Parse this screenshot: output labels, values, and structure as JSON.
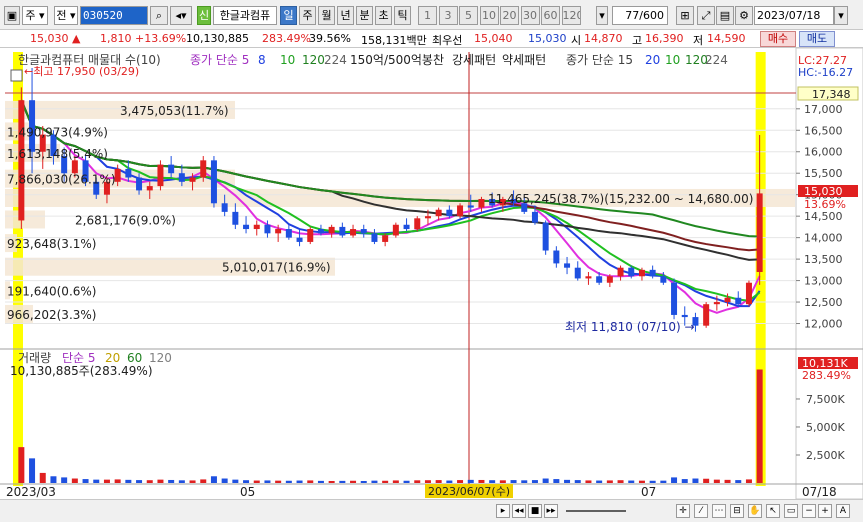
{
  "toolbar": {
    "market": "주",
    "all": "전",
    "stock_code": "030520",
    "badge": "신",
    "stock_name": "한글과컴퓨",
    "periods": [
      "일",
      "주",
      "월",
      "년",
      "분",
      "초",
      "틱"
    ],
    "active_period": "일",
    "intervals": [
      "1",
      "3",
      "5",
      "10",
      "20",
      "30",
      "60",
      "120"
    ],
    "count": "77",
    "count_total": "/600",
    "date": "2023/07/18"
  },
  "quote": {
    "price": "15,030",
    "change": "1,810",
    "change_pct": "+13.69%",
    "volume": "10,130,885",
    "volume_ratio": "283.49%",
    "turnover": "39.56%",
    "amount": "158,131백만",
    "best_label": "최우선",
    "ask": "15,040",
    "bid": "15,030",
    "open_label": "시",
    "open": "14,870",
    "high_label": "고",
    "high": "16,390",
    "low_label": "저",
    "low": "14,590",
    "buy": "매수",
    "sell": "매도"
  },
  "indicators": {
    "title": "한글과컴퓨터 매물대 수(10)",
    "ma_label": "종가 단순 5",
    "ma_periods": [
      "8",
      "10",
      "120",
      "224"
    ],
    "pattern1": "150억/500억봉찬",
    "pattern2": "강세패턴",
    "pattern3": "약세패턴",
    "ma2_label": "종가 단순 15",
    "ma2_periods": [
      "20",
      "10",
      "120",
      "224"
    ],
    "lc": "LC:27.27",
    "hc": "HC:-16.27"
  },
  "annotations": {
    "high": "최고 17,950 (03/29)",
    "low": "최저 11,810 (07/10)",
    "current_price": "17,348",
    "price_tag": "15,030",
    "pct_tag": "13.69%",
    "volume_tag": "10,131K",
    "volume_pct_tag": "283.49%",
    "crosshair_date": "2023/06/07(수)"
  },
  "volume_profile": [
    {
      "label": "3,475,053(11.7%)",
      "price": 16950
    },
    {
      "label": "1,490,973(4.9%)",
      "price": 16450
    },
    {
      "label": "1,613,148(5.4%)",
      "price": 15950
    },
    {
      "label": "7,866,030(26.1%)",
      "price": 15350
    },
    {
      "label": "2,681,176(9.0%)",
      "price": 14400
    },
    {
      "label": "923,648(3.1%)",
      "price": 13850
    },
    {
      "label": "5,010,017(16.9%)",
      "price": 13300
    },
    {
      "label": "191,640(0.6%)",
      "price": 12750
    },
    {
      "label": "966,202(3.3%)",
      "price": 12200
    },
    {
      "label": "11,465,245(38.7%)(15,232.00 ~ 14,680.00)",
      "price": 14900
    }
  ],
  "volume_panel": {
    "label": "거래량",
    "ma": "단순 5",
    "periods": [
      "20",
      "60",
      "120"
    ],
    "value": "10,130,885주(283.49%)"
  },
  "x_axis": [
    "2023/03",
    "05",
    "07",
    "07/18"
  ],
  "chart_data": {
    "type": "candlestick",
    "title": "한글과컴퓨터",
    "ylim": [
      11500,
      17950
    ],
    "yticks": [
      17000,
      16500,
      16000,
      15500,
      15000,
      14500,
      14000,
      13500,
      13000,
      12500,
      12000
    ],
    "volume_ticks": [
      "7,500K",
      "5,000K",
      "2,500K"
    ],
    "candles": [
      {
        "o": 14400,
        "h": 17500,
        "l": 14200,
        "c": 17200,
        "v": 3200
      },
      {
        "o": 17200,
        "h": 17950,
        "l": 15500,
        "c": 16000,
        "v": 2200
      },
      {
        "o": 16000,
        "h": 16600,
        "l": 15600,
        "c": 16400,
        "v": 900
      },
      {
        "o": 16400,
        "h": 16500,
        "l": 15700,
        "c": 15900,
        "v": 600
      },
      {
        "o": 15900,
        "h": 16100,
        "l": 15300,
        "c": 15500,
        "v": 500
      },
      {
        "o": 15500,
        "h": 15900,
        "l": 15400,
        "c": 15800,
        "v": 400
      },
      {
        "o": 15800,
        "h": 15900,
        "l": 15200,
        "c": 15300,
        "v": 350
      },
      {
        "o": 15300,
        "h": 15400,
        "l": 14900,
        "c": 15000,
        "v": 300
      },
      {
        "o": 15000,
        "h": 15400,
        "l": 14800,
        "c": 15300,
        "v": 300
      },
      {
        "o": 15300,
        "h": 15700,
        "l": 15200,
        "c": 15600,
        "v": 320
      },
      {
        "o": 15600,
        "h": 15800,
        "l": 15300,
        "c": 15400,
        "v": 280
      },
      {
        "o": 15400,
        "h": 15500,
        "l": 15000,
        "c": 15100,
        "v": 260
      },
      {
        "o": 15100,
        "h": 15300,
        "l": 14900,
        "c": 15200,
        "v": 250
      },
      {
        "o": 15200,
        "h": 15800,
        "l": 15100,
        "c": 15700,
        "v": 300
      },
      {
        "o": 15700,
        "h": 15900,
        "l": 15400,
        "c": 15500,
        "v": 270
      },
      {
        "o": 15500,
        "h": 15700,
        "l": 15200,
        "c": 15300,
        "v": 240
      },
      {
        "o": 15300,
        "h": 15500,
        "l": 15100,
        "c": 15400,
        "v": 230
      },
      {
        "o": 15400,
        "h": 15900,
        "l": 15300,
        "c": 15800,
        "v": 320
      },
      {
        "o": 15800,
        "h": 15900,
        "l": 14700,
        "c": 14800,
        "v": 600
      },
      {
        "o": 14800,
        "h": 15000,
        "l": 14500,
        "c": 14600,
        "v": 400
      },
      {
        "o": 14600,
        "h": 14800,
        "l": 14200,
        "c": 14300,
        "v": 300
      },
      {
        "o": 14300,
        "h": 14500,
        "l": 14100,
        "c": 14200,
        "v": 250
      },
      {
        "o": 14200,
        "h": 14400,
        "l": 14050,
        "c": 14300,
        "v": 220
      },
      {
        "o": 14300,
        "h": 14400,
        "l": 14000,
        "c": 14100,
        "v": 230
      },
      {
        "o": 14100,
        "h": 14300,
        "l": 13900,
        "c": 14200,
        "v": 210
      },
      {
        "o": 14200,
        "h": 14300,
        "l": 13950,
        "c": 14000,
        "v": 200
      },
      {
        "o": 14000,
        "h": 14200,
        "l": 13800,
        "c": 13900,
        "v": 220
      },
      {
        "o": 13900,
        "h": 14250,
        "l": 13850,
        "c": 14200,
        "v": 230
      },
      {
        "o": 14200,
        "h": 14300,
        "l": 14050,
        "c": 14100,
        "v": 190
      },
      {
        "o": 14100,
        "h": 14300,
        "l": 14000,
        "c": 14250,
        "v": 180
      },
      {
        "o": 14250,
        "h": 14350,
        "l": 14000,
        "c": 14050,
        "v": 190
      },
      {
        "o": 14050,
        "h": 14300,
        "l": 14000,
        "c": 14200,
        "v": 200
      },
      {
        "o": 14200,
        "h": 14300,
        "l": 14000,
        "c": 14100,
        "v": 180
      },
      {
        "o": 14100,
        "h": 14200,
        "l": 13850,
        "c": 13900,
        "v": 210
      },
      {
        "o": 13900,
        "h": 14100,
        "l": 13800,
        "c": 14050,
        "v": 200
      },
      {
        "o": 14050,
        "h": 14350,
        "l": 14000,
        "c": 14300,
        "v": 230
      },
      {
        "o": 14300,
        "h": 14450,
        "l": 14150,
        "c": 14200,
        "v": 200
      },
      {
        "o": 14200,
        "h": 14500,
        "l": 14150,
        "c": 14450,
        "v": 240
      },
      {
        "o": 14450,
        "h": 14650,
        "l": 14300,
        "c": 14500,
        "v": 250
      },
      {
        "o": 14500,
        "h": 14700,
        "l": 14400,
        "c": 14650,
        "v": 260
      },
      {
        "o": 14650,
        "h": 14750,
        "l": 14450,
        "c": 14500,
        "v": 220
      },
      {
        "o": 14500,
        "h": 14800,
        "l": 14450,
        "c": 14750,
        "v": 260
      },
      {
        "o": 14750,
        "h": 15000,
        "l": 14600,
        "c": 14700,
        "v": 280
      },
      {
        "o": 14700,
        "h": 14950,
        "l": 14600,
        "c": 14900,
        "v": 270
      },
      {
        "o": 14900,
        "h": 15050,
        "l": 14700,
        "c": 14750,
        "v": 250
      },
      {
        "o": 14750,
        "h": 14950,
        "l": 14600,
        "c": 14900,
        "v": 240
      },
      {
        "o": 14900,
        "h": 15100,
        "l": 14750,
        "c": 14800,
        "v": 260
      },
      {
        "o": 14800,
        "h": 14950,
        "l": 14550,
        "c": 14600,
        "v": 240
      },
      {
        "o": 14600,
        "h": 14750,
        "l": 14300,
        "c": 14350,
        "v": 260
      },
      {
        "o": 14350,
        "h": 14400,
        "l": 13600,
        "c": 13700,
        "v": 400
      },
      {
        "o": 13700,
        "h": 13800,
        "l": 13300,
        "c": 13400,
        "v": 350
      },
      {
        "o": 13400,
        "h": 13550,
        "l": 13150,
        "c": 13300,
        "v": 280
      },
      {
        "o": 13300,
        "h": 13450,
        "l": 13000,
        "c": 13050,
        "v": 260
      },
      {
        "o": 13050,
        "h": 13200,
        "l": 12900,
        "c": 13100,
        "v": 230
      },
      {
        "o": 13100,
        "h": 13200,
        "l": 12900,
        "c": 12950,
        "v": 220
      },
      {
        "o": 12950,
        "h": 13150,
        "l": 12850,
        "c": 13100,
        "v": 230
      },
      {
        "o": 13100,
        "h": 13350,
        "l": 13000,
        "c": 13300,
        "v": 250
      },
      {
        "o": 13300,
        "h": 13350,
        "l": 13050,
        "c": 13100,
        "v": 220
      },
      {
        "o": 13100,
        "h": 13300,
        "l": 13000,
        "c": 13250,
        "v": 210
      },
      {
        "o": 13250,
        "h": 13350,
        "l": 13050,
        "c": 13100,
        "v": 200
      },
      {
        "o": 13100,
        "h": 13200,
        "l": 12900,
        "c": 12950,
        "v": 210
      },
      {
        "o": 12950,
        "h": 13050,
        "l": 12100,
        "c": 12200,
        "v": 500
      },
      {
        "o": 12200,
        "h": 12400,
        "l": 11950,
        "c": 12150,
        "v": 350
      },
      {
        "o": 12150,
        "h": 12250,
        "l": 11810,
        "c": 11950,
        "v": 400
      },
      {
        "o": 11950,
        "h": 12500,
        "l": 11900,
        "c": 12450,
        "v": 380
      },
      {
        "o": 12450,
        "h": 12650,
        "l": 12300,
        "c": 12500,
        "v": 300
      },
      {
        "o": 12500,
        "h": 12700,
        "l": 12400,
        "c": 12600,
        "v": 280
      },
      {
        "o": 12600,
        "h": 12750,
        "l": 12400,
        "c": 12450,
        "v": 260
      },
      {
        "o": 12450,
        "h": 13000,
        "l": 12400,
        "c": 12950,
        "v": 320
      },
      {
        "o": 13200,
        "h": 16390,
        "l": 12900,
        "c": 15030,
        "v": 10131
      }
    ],
    "ma_series": [
      {
        "name": "5",
        "color": "#e030e0"
      },
      {
        "name": "8",
        "color": "#2040e0"
      },
      {
        "name": "10",
        "color": "#20c020"
      },
      {
        "name": "120",
        "color": "#303030"
      },
      {
        "name": "224",
        "color": "#802020"
      }
    ]
  }
}
